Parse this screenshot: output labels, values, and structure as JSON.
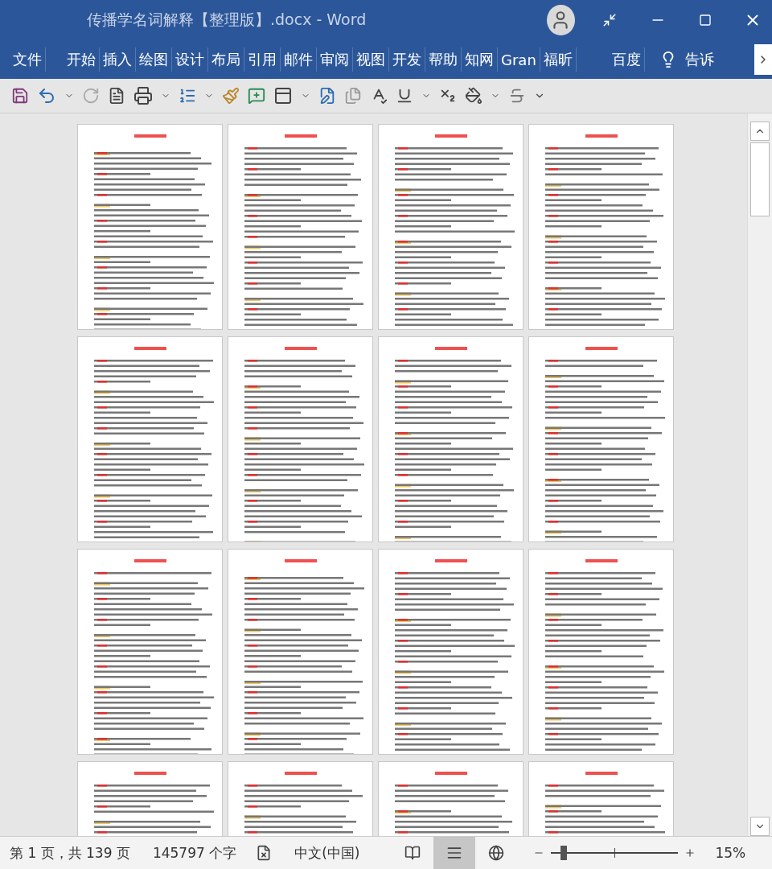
{
  "window": {
    "title": "传播学名词解释【整理版】.docx  -  Word"
  },
  "ribbon": {
    "tabs": [
      {
        "label": "文件",
        "selected": false
      },
      {
        "label": "开始",
        "selected": false
      },
      {
        "label": "插入",
        "selected": false
      },
      {
        "label": "绘图",
        "selected": false
      },
      {
        "label": "设计",
        "selected": false
      },
      {
        "label": "布局",
        "selected": false
      },
      {
        "label": "引用",
        "selected": false
      },
      {
        "label": "邮件",
        "selected": false
      },
      {
        "label": "审阅",
        "selected": false
      },
      {
        "label": "视图",
        "selected": false
      },
      {
        "label": "开发",
        "selected": false
      },
      {
        "label": "帮助",
        "selected": false
      },
      {
        "label": "知网",
        "selected": false
      },
      {
        "label": "Gran",
        "selected": false
      },
      {
        "label": "福昕",
        "selected": false
      },
      {
        "label": "百度",
        "selected": false
      }
    ],
    "tell_me": "告诉"
  },
  "status_bar": {
    "page": "第 1 页，共 139 页",
    "words": "145797 个字",
    "language": "中文(中国)",
    "views": [
      {
        "kind": "read",
        "selected": false
      },
      {
        "kind": "print",
        "selected": true
      },
      {
        "kind": "web",
        "selected": false
      }
    ],
    "zoom": {
      "level": 0.1,
      "reading": "15%"
    }
  }
}
